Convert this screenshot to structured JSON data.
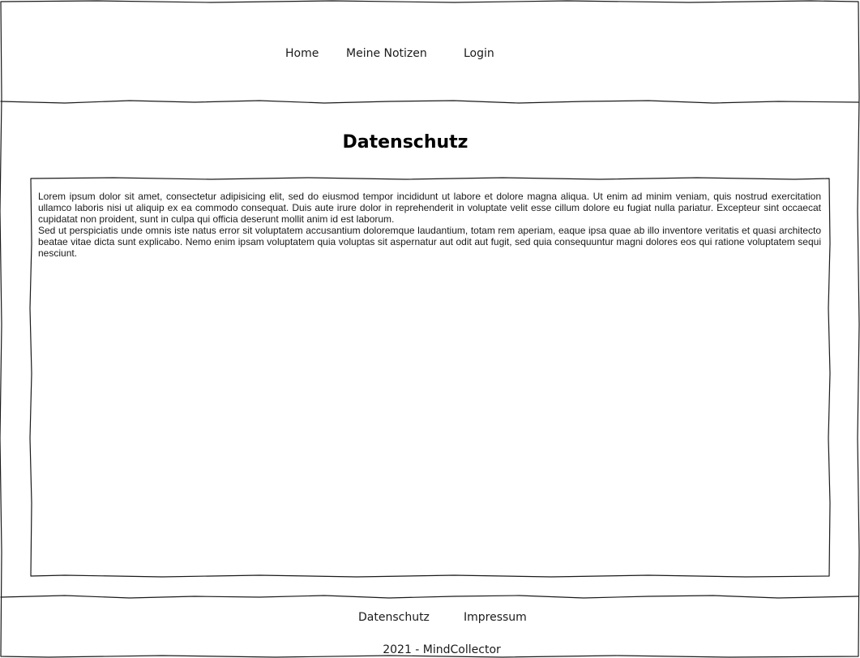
{
  "nav": {
    "home": "Home",
    "notes": "Meine Notizen",
    "login": "Login"
  },
  "page": {
    "title": "Datenschutz"
  },
  "content": {
    "paragraphs": [
      "Lorem ipsum dolor sit amet, consectetur adipisicing elit, sed do eiusmod tempor incididunt ut labore et dolore magna aliqua. Ut enim ad minim veniam, quis nostrud exercitation ullamco laboris nisi ut aliquip ex ea commodo consequat. Duis aute irure dolor in reprehenderit in voluptate velit esse cillum dolore eu fugiat nulla pariatur. Excepteur sint occaecat cupidatat non proident, sunt in culpa qui officia deserunt mollit anim id est laborum.",
      "Sed ut perspiciatis unde omnis iste natus error sit voluptatem accusantium doloremque laudantium, totam rem aperiam, eaque ipsa quae ab illo inventore veritatis et quasi architecto beatae vitae dicta sunt explicabo. Nemo enim ipsam voluptatem quia voluptas sit aspernatur aut odit aut fugit, sed quia consequuntur magni dolores eos qui ratione voluptatem sequi nesciunt."
    ]
  },
  "footer": {
    "privacy": "Datenschutz",
    "imprint": "Impressum",
    "copyright": "2021 - MindCollector"
  }
}
